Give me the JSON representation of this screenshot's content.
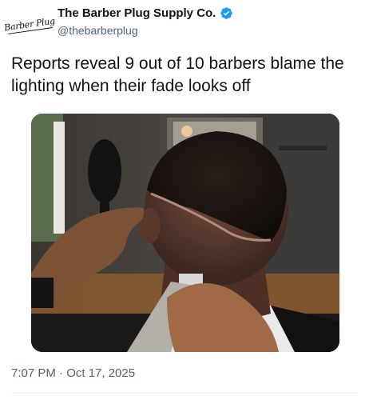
{
  "tweet": {
    "avatar_logo_text": "Barber Plug",
    "display_name": "The Barber Plug Supply Co.",
    "handle": "@thebarberplug",
    "verified": true,
    "text": "Reports reveal 9 out of 10 barbers blame the lighting when their fade looks off",
    "timestamp": "7:07 PM · Oct 17, 2025",
    "verified_color": "#1d9bf0"
  }
}
